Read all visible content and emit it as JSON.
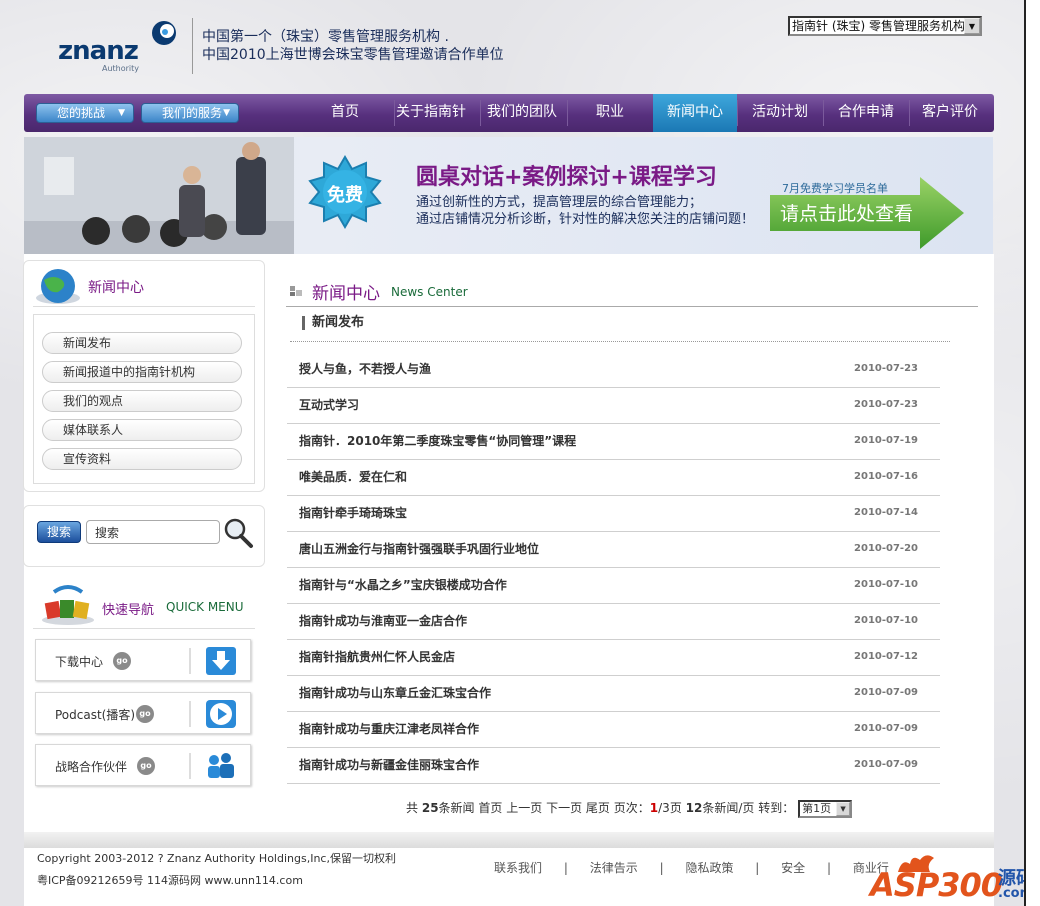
{
  "header": {
    "logo_text": "znanz",
    "logo_sub": "Authority",
    "tagline_1": "中国第一个（珠宝）零售管理服务机构 .",
    "tagline_2": "中国2010上海世博会珠宝零售管理邀请合作单位",
    "org_select_value": "指南针 (珠宝) 零售管理服务机构"
  },
  "nav": {
    "pill_1": "您的挑战",
    "pill_2": "我们的服务",
    "items": [
      "首页",
      "关于指南针",
      "我们的团队",
      "职业",
      "新闻中心",
      "活动计划",
      "合作申请",
      "客户评价"
    ],
    "active_index": 4
  },
  "banner": {
    "badge": "免费",
    "headline": "圆桌对话+案例探讨+课程学习",
    "desc_1": "通过创新性的方式，提高管理层的综合管理能力；",
    "desc_2": "通过店铺情况分析诊断，针对性的解决您关注的店铺问题！",
    "small": "7月免费学习学员名单",
    "cta": "请点击此处查看"
  },
  "sidebar": {
    "news_title": "新闻中心",
    "news_items": [
      "新闻发布",
      "新闻报道中的指南针机构",
      "我们的观点",
      "媒体联系人",
      "宣传资料"
    ],
    "search_button": "搜索",
    "search_value": "搜索",
    "quick_title": "快速导航",
    "quick_title_en": "QUICK MENU",
    "quick_items": [
      "下载中心",
      "Podcast(播客)",
      "战略合作伙伴"
    ],
    "go_label": "go"
  },
  "content": {
    "title": "新闻中心",
    "title_en": "News Center",
    "section": "新闻发布",
    "news": [
      {
        "title": "授人与鱼，不若授人与渔",
        "date": "2010-07-23"
      },
      {
        "title": "互动式学习",
        "date": "2010-07-23"
      },
      {
        "title": "指南针．2010年第二季度珠宝零售“协同管理”课程",
        "date": "2010-07-19"
      },
      {
        "title": "唯美品质．爱在仁和",
        "date": "2010-07-16"
      },
      {
        "title": "指南针牵手琦琦珠宝",
        "date": "2010-07-14"
      },
      {
        "title": "唐山五洲金行与指南针强强联手巩固行业地位",
        "date": "2010-07-20"
      },
      {
        "title": "指南针与“水晶之乡”宝庆银楼成功合作",
        "date": "2010-07-10"
      },
      {
        "title": "指南针成功与淮南亚一金店合作",
        "date": "2010-07-10"
      },
      {
        "title": "指南针指航贵州仁怀人民金店",
        "date": "2010-07-12"
      },
      {
        "title": "指南针成功与山东章丘金汇珠宝合作",
        "date": "2010-07-09"
      },
      {
        "title": "指南针成功与重庆江津老凤祥合作",
        "date": "2010-07-09"
      },
      {
        "title": "指南针成功与新疆金佳丽珠宝合作",
        "date": "2010-07-09"
      }
    ],
    "pager": {
      "prefix": "共",
      "total": "25",
      "unit": "条新闻",
      "first": "首页",
      "prev": "上一页",
      "next": "下一页",
      "last": "尾页",
      "page_label": "页次：",
      "current": "1",
      "pages": "/3页",
      "per_page": "12",
      "per_page_label": "条新闻/页",
      "goto": "转到：",
      "select_value": "第1页"
    }
  },
  "footer": {
    "copyright": "Copyright 2003-2012 ? Znanz Authority Holdings,Inc,保留一切权利",
    "icp": "粤ICP备09212659号  114源码网  www.unn114.com",
    "links": [
      "联系我们",
      "|",
      "法律告示",
      "|",
      "隐私政策",
      "|",
      "安全",
      "|",
      "商业行"
    ],
    "watermark": "ASP300",
    "watermark_cn": "源码",
    "watermark_com": ".com"
  }
}
